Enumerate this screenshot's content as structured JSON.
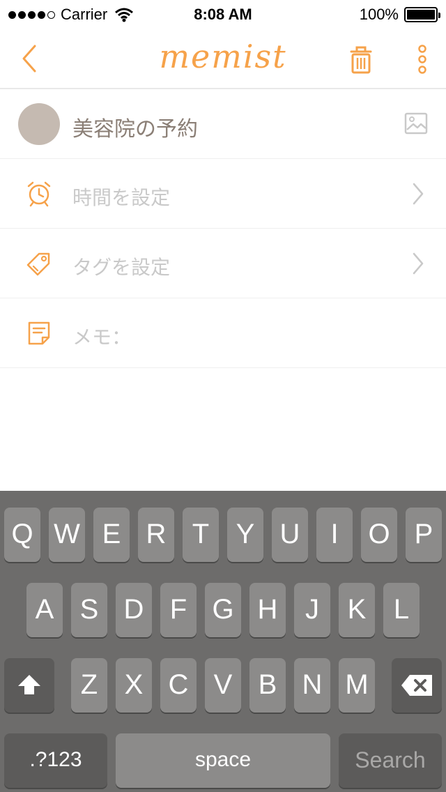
{
  "status_bar": {
    "carrier": "Carrier",
    "time": "8:08 AM",
    "battery": "100%",
    "battery_level": 1.0
  },
  "nav": {
    "title": "memist",
    "back_icon": "chevron-left-icon",
    "trash_icon": "trash-icon",
    "more_icon": "more-vertical-icon",
    "accent_color": "#f6a24a"
  },
  "task": {
    "title": "美容院の予約",
    "image_icon": "image-icon"
  },
  "rows": {
    "time": {
      "label": "時間を設定",
      "icon": "alarm-clock-icon"
    },
    "tag": {
      "label": "タグを設定",
      "icon": "tag-icon"
    },
    "memo": {
      "label": "メモ：",
      "icon": "note-icon"
    }
  },
  "keyboard": {
    "row1": [
      "Q",
      "W",
      "E",
      "R",
      "T",
      "Y",
      "U",
      "I",
      "O",
      "P"
    ],
    "row2": [
      "A",
      "S",
      "D",
      "F",
      "G",
      "H",
      "J",
      "K",
      "L"
    ],
    "row3": [
      "Z",
      "X",
      "C",
      "V",
      "B",
      "N",
      "M"
    ],
    "numbers_label": ".?123",
    "space_label": "space",
    "search_label": "Search"
  }
}
